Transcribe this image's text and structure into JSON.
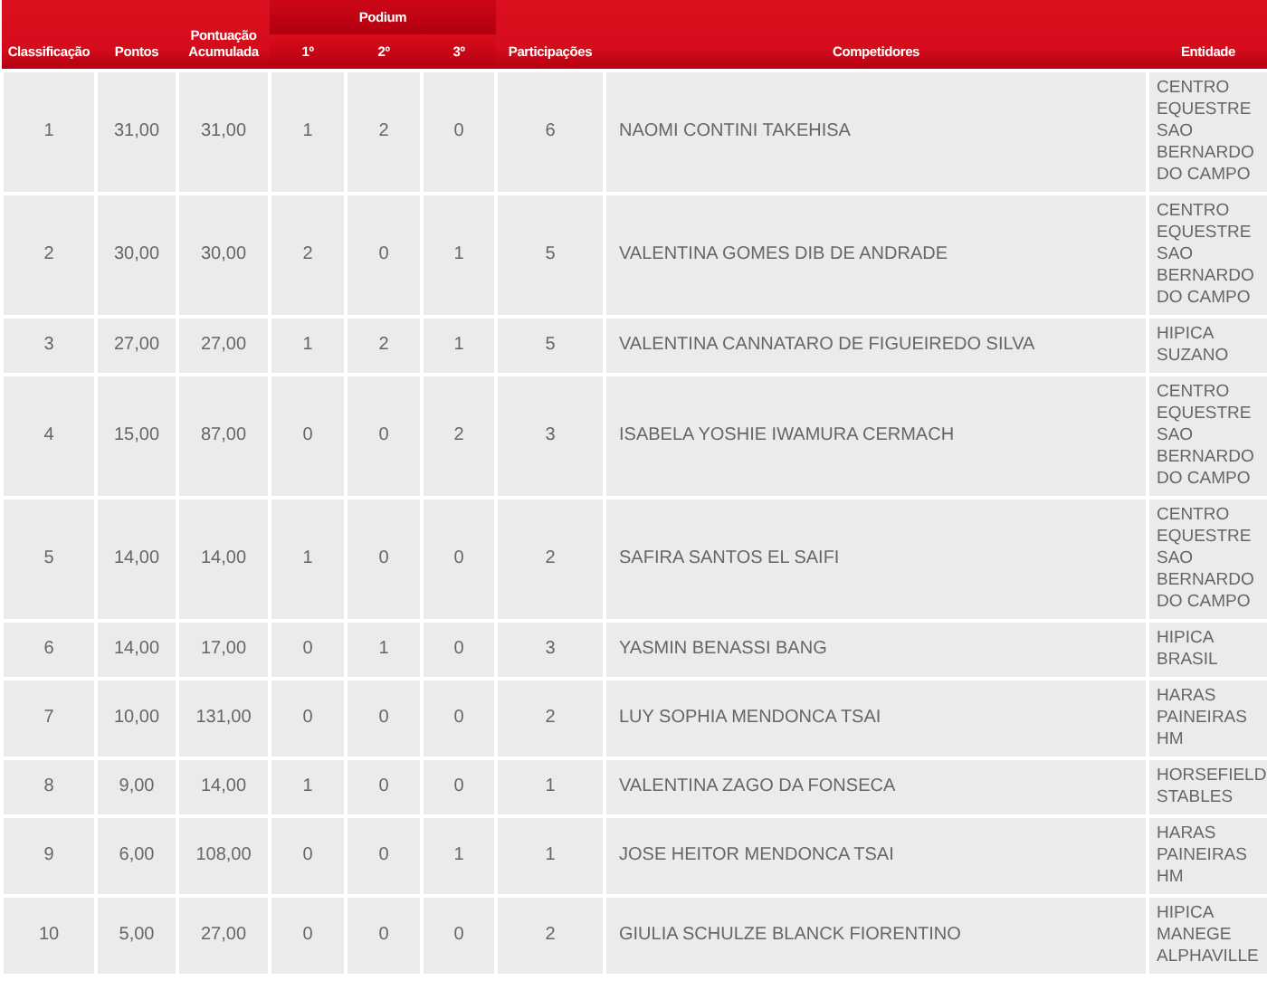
{
  "table": {
    "columns": [
      {
        "label": "Classificação"
      },
      {
        "label": "Pontos"
      },
      {
        "label": "Pontuação Acumulada"
      },
      {
        "label": "Podium",
        "sub": [
          "1º",
          "2º",
          "3º"
        ]
      },
      {
        "label": "Participações"
      },
      {
        "label": "Competidores"
      },
      {
        "label": "Entidade"
      }
    ],
    "rows": [
      {
        "rank": "1",
        "points": "31,00",
        "accumulated": "31,00",
        "first": "1",
        "second": "2",
        "third": "0",
        "participations": "6",
        "competitor": "NAOMI CONTINI TAKEHISA",
        "entity": "CENTRO EQUESTRE SAO BERNARDO DO CAMPO"
      },
      {
        "rank": "2",
        "points": "30,00",
        "accumulated": "30,00",
        "first": "2",
        "second": "0",
        "third": "1",
        "participations": "5",
        "competitor": "VALENTINA GOMES DIB DE ANDRADE",
        "entity": "CENTRO EQUESTRE SAO BERNARDO DO CAMPO"
      },
      {
        "rank": "3",
        "points": "27,00",
        "accumulated": "27,00",
        "first": "1",
        "second": "2",
        "third": "1",
        "participations": "5",
        "competitor": "VALENTINA CANNATARO DE FIGUEIREDO SILVA",
        "entity": "HIPICA SUZANO"
      },
      {
        "rank": "4",
        "points": "15,00",
        "accumulated": "87,00",
        "first": "0",
        "second": "0",
        "third": "2",
        "participations": "3",
        "competitor": "ISABELA YOSHIE IWAMURA CERMACH",
        "entity": "CENTRO EQUESTRE SAO BERNARDO DO CAMPO"
      },
      {
        "rank": "5",
        "points": "14,00",
        "accumulated": "14,00",
        "first": "1",
        "second": "0",
        "third": "0",
        "participations": "2",
        "competitor": "SAFIRA SANTOS EL SAIFI",
        "entity": "CENTRO EQUESTRE SAO BERNARDO DO CAMPO"
      },
      {
        "rank": "6",
        "points": "14,00",
        "accumulated": "17,00",
        "first": "0",
        "second": "1",
        "third": "0",
        "participations": "3",
        "competitor": "YASMIN BENASSI BANG",
        "entity": "HIPICA BRASIL"
      },
      {
        "rank": "7",
        "points": "10,00",
        "accumulated": "131,00",
        "first": "0",
        "second": "0",
        "third": "0",
        "participations": "2",
        "competitor": "LUY SOPHIA MENDONCA TSAI",
        "entity": "HARAS PAINEIRAS HM"
      },
      {
        "rank": "8",
        "points": "9,00",
        "accumulated": "14,00",
        "first": "1",
        "second": "0",
        "third": "0",
        "participations": "1",
        "competitor": "VALENTINA ZAGO DA FONSECA",
        "entity": "HORSEFIELD STABLES"
      },
      {
        "rank": "9",
        "points": "6,00",
        "accumulated": "108,00",
        "first": "0",
        "second": "0",
        "third": "1",
        "participations": "1",
        "competitor": "JOSE HEITOR MENDONCA TSAI",
        "entity": "HARAS PAINEIRAS HM"
      },
      {
        "rank": "10",
        "points": "5,00",
        "accumulated": "27,00",
        "first": "0",
        "second": "0",
        "third": "0",
        "participations": "2",
        "competitor": "GIULIA SCHULZE BLANCK FIORENTINO",
        "entity": "HIPICA MANEGE ALPHAVILLE"
      }
    ]
  }
}
